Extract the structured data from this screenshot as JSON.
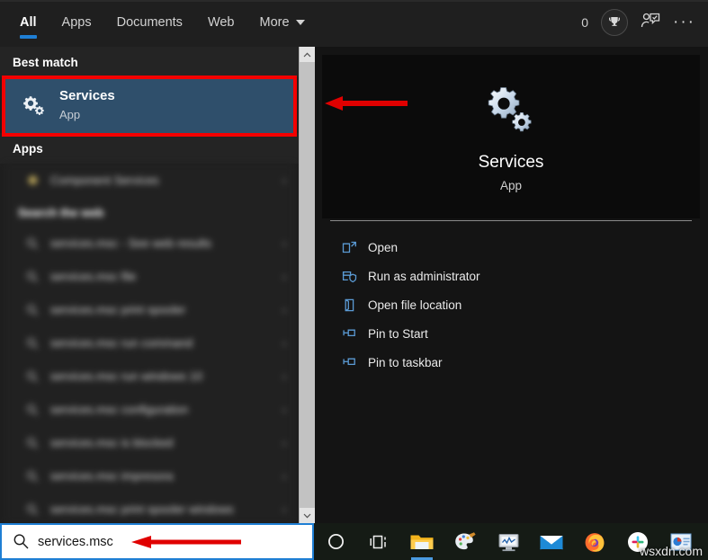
{
  "tabbar": {
    "tabs": [
      {
        "label": "All",
        "active": true
      },
      {
        "label": "Apps",
        "active": false
      },
      {
        "label": "Documents",
        "active": false
      },
      {
        "label": "Web",
        "active": false
      },
      {
        "label": "More",
        "active": false,
        "has_caret": true
      }
    ],
    "reward_count": "0",
    "reward_icon": "trophy-icon",
    "feedback_icon": "person-feedback-icon",
    "overflow_label": "···"
  },
  "left_pane": {
    "best_match_header": "Best match",
    "best_match": {
      "title": "Services",
      "subtitle": "App",
      "icon": "gears-icon",
      "highlighted": true
    },
    "apps_header": "Apps",
    "blurred_items": [
      {
        "label": "Component Services",
        "icon": "app-icon"
      }
    ],
    "web_header": "Search the web",
    "web_items": [
      {
        "label": "services.msc - See web results",
        "icon": "search-icon"
      },
      {
        "label": "services.msc file",
        "icon": "search-icon"
      },
      {
        "label": "services.msc print spooler",
        "icon": "search-icon"
      },
      {
        "label": "services.msc run command",
        "icon": "search-icon"
      },
      {
        "label": "services.msc run windows 10",
        "icon": "search-icon"
      },
      {
        "label": "services.msc configuration",
        "icon": "search-icon"
      },
      {
        "label": "services.msc is blocked",
        "icon": "search-icon"
      },
      {
        "label": "services.msc impresora",
        "icon": "search-icon"
      },
      {
        "label": "services.msc print spooler windows",
        "icon": "search-icon"
      }
    ]
  },
  "preview": {
    "app_icon": "gears-icon",
    "app_title": "Services",
    "app_subtitle": "App",
    "actions": [
      {
        "label": "Open",
        "icon": "open-window-icon"
      },
      {
        "label": "Run as administrator",
        "icon": "shield-window-icon"
      },
      {
        "label": "Open file location",
        "icon": "folder-open-icon"
      },
      {
        "label": "Pin to Start",
        "icon": "pin-icon"
      },
      {
        "label": "Pin to taskbar",
        "icon": "pin-icon"
      }
    ]
  },
  "search": {
    "value": "services.msc",
    "icon": "search-icon"
  },
  "taskbar": {
    "items": [
      {
        "name": "cortana-icon",
        "active": false
      },
      {
        "name": "task-view-icon",
        "active": false
      },
      {
        "name": "file-explorer-icon",
        "active": true
      },
      {
        "name": "paint-icon",
        "active": false
      },
      {
        "name": "performance-monitor-icon",
        "active": false
      },
      {
        "name": "mail-icon",
        "active": false
      },
      {
        "name": "firefox-icon",
        "active": true
      },
      {
        "name": "slack-icon",
        "active": false
      },
      {
        "name": "powerpoint-icon",
        "active": false
      }
    ]
  },
  "annotations": {
    "red_box_target": "Services",
    "arrow_preview": "red-arrow-left",
    "arrow_search": "red-arrow-left"
  },
  "watermark": "wsxdn.com",
  "colors": {
    "accent_blue": "#1f7fd4",
    "highlight_row": "#2f4f6b",
    "annotation_red": "#f40000",
    "pane_bg": "#1f1f1f",
    "preview_bg": "#141414"
  }
}
